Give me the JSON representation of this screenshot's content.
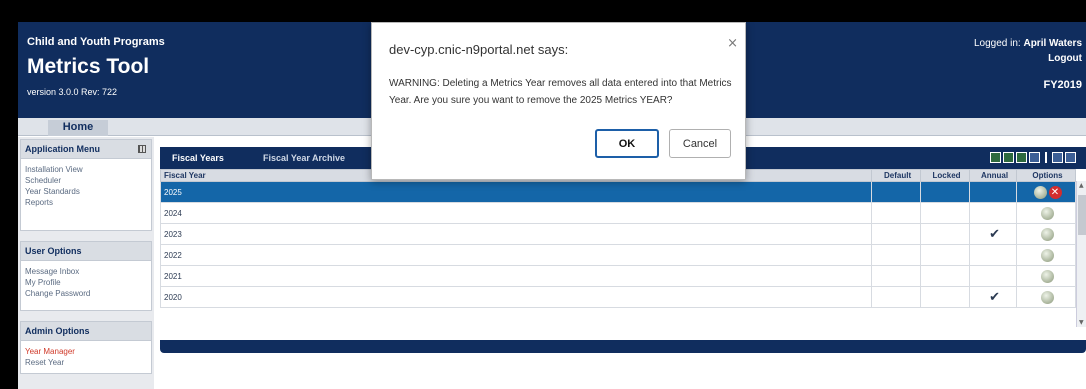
{
  "header": {
    "org": "Child and Youth Programs",
    "app_title": "Metrics Tool",
    "version": "version 3.0.0 Rev: 722",
    "logged_in_label": "Logged in:",
    "user_name": "April Waters",
    "logout": "Logout",
    "fiscal_year": "FY2019"
  },
  "nav": {
    "home": "Home"
  },
  "sidebar": {
    "app_menu": {
      "title": "Application Menu",
      "items": [
        "Installation View",
        "Scheduler",
        "Year Standards",
        "Reports"
      ]
    },
    "user_options": {
      "title": "User Options",
      "items": [
        "Message Inbox",
        "My Profile",
        "Change Password"
      ]
    },
    "admin_options": {
      "title": "Admin Options",
      "items": [
        "Year Manager",
        "Reset Year"
      ]
    }
  },
  "tabs": {
    "fiscal_years": "Fiscal Years",
    "archive": "Fiscal Year Archive"
  },
  "table": {
    "headers": {
      "fiscal_year": "Fiscal Year",
      "default": "Default",
      "locked": "Locked",
      "annual": "Annual",
      "options": "Options"
    },
    "rows": [
      {
        "year": "2025",
        "annual": "",
        "selected": true
      },
      {
        "year": "2024",
        "annual": ""
      },
      {
        "year": "2023",
        "annual": "✔"
      },
      {
        "year": "2022",
        "annual": ""
      },
      {
        "year": "2021",
        "annual": ""
      },
      {
        "year": "2020",
        "annual": "✔"
      }
    ]
  },
  "dialog": {
    "title": "dev-cyp.cnic-n9portal.net says:",
    "message": "WARNING: Deleting a Metrics Year removes all data entered into that Metrics Year.  Are you sure you want to remove the 2025 Metrics YEAR?",
    "ok": "OK",
    "cancel": "Cancel",
    "close": "×"
  },
  "colors": {
    "navy": "#102d5e",
    "selected_row": "#1466a8",
    "active_link": "#d03a2a"
  }
}
